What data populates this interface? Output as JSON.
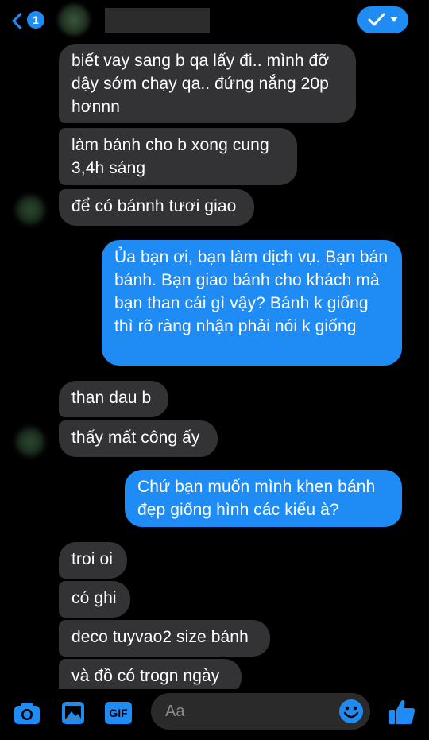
{
  "header": {
    "unread_count": "1",
    "contact_name": ""
  },
  "messages": [
    {
      "side": "in",
      "text": "biết vay sang b qa lấy đi.. mình đỡ dậy sớm chạy qa.. đứng nắng 20p hơnnn"
    },
    {
      "side": "in",
      "text": "làm bánh cho b xong cung 3,4h sáng"
    },
    {
      "side": "in",
      "text": "để có bánnh tươi giao"
    },
    {
      "side": "out",
      "text": "Ủa bạn ơi, bạn làm dịch vụ. Bạn bán bánh. Bạn giao bánh cho khách mà bạn than cái gì vậy? Bánh k giống thì rõ ràng nhận phải nói k giống"
    },
    {
      "side": "in",
      "text": "than dau b"
    },
    {
      "side": "in",
      "text": "thấy mất công ấy"
    },
    {
      "side": "out",
      "text": "Chứ bạn muốn mình khen bánh đẹp giống hình các kiểu à?"
    },
    {
      "side": "in",
      "text": "troi oi"
    },
    {
      "side": "in",
      "text": "có ghi"
    },
    {
      "side": "in",
      "text": "deco tuyvao2 size bánh"
    },
    {
      "side": "in",
      "text": "và đồ có trogn ngày"
    }
  ],
  "composer": {
    "placeholder": "Aa",
    "gif_label": "GIF"
  },
  "colors": {
    "accent": "#1f8bf5",
    "incoming_bubble": "#333336",
    "background": "#000000"
  },
  "icons": [
    "camera-icon",
    "photo-icon",
    "gif-icon",
    "emoji-icon",
    "like-icon",
    "check-icon",
    "back-chevron-icon"
  ]
}
